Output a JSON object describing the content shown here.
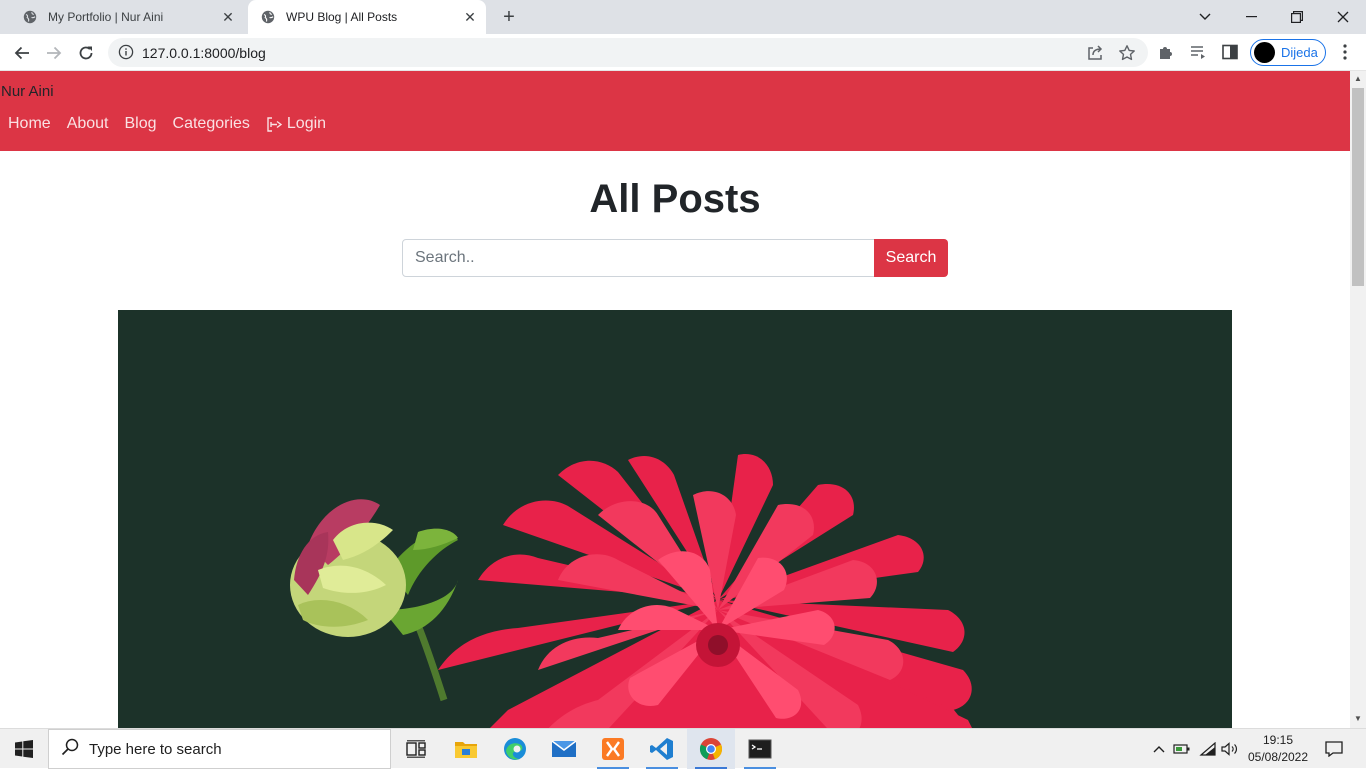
{
  "browser": {
    "tabs": [
      {
        "title": "My Portfolio | Nur Aini"
      },
      {
        "title": "WPU Blog | All Posts"
      }
    ],
    "url": "127.0.0.1:8000/blog",
    "profile_name": "Dijeda"
  },
  "site": {
    "brand": "Nur Aini",
    "nav": [
      "Home",
      "About",
      "Blog",
      "Categories"
    ],
    "login_label": "Login",
    "page_title": "All Posts",
    "search_placeholder": "Search..",
    "search_button": "Search",
    "accent_color": "#dc3545",
    "hero_bg_color": "#1c3229"
  },
  "taskbar": {
    "search_placeholder": "Type here to search",
    "time": "19:15",
    "date": "05/08/2022"
  }
}
